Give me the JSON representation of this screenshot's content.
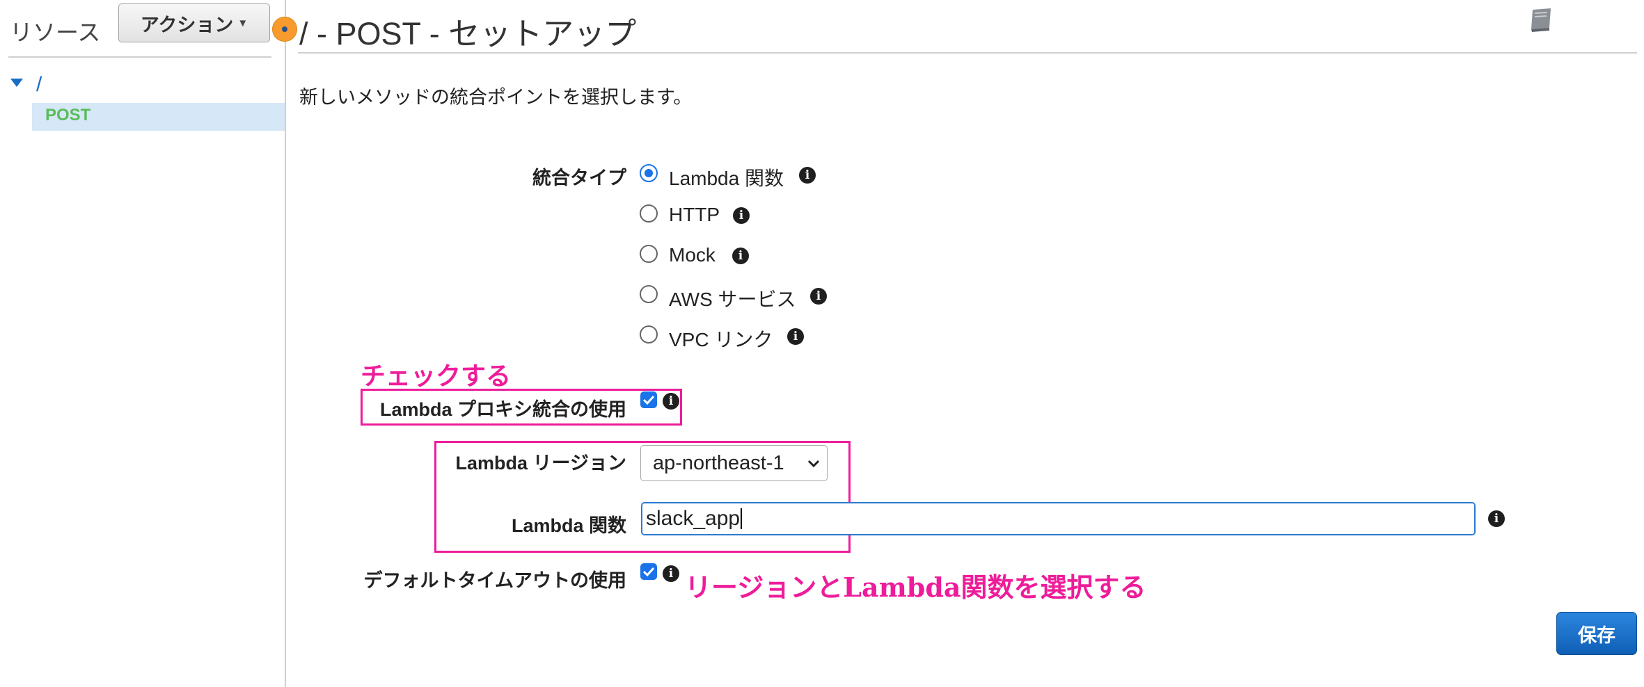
{
  "sidebar": {
    "resources_label": "リソース",
    "actions_button": "アクション",
    "tree": {
      "root": "/",
      "children": [
        {
          "label": "POST"
        }
      ]
    }
  },
  "header": {
    "title": "/ - POST - セットアップ"
  },
  "intro": "新しいメソッドの統合ポイントを選択します。",
  "form": {
    "integration_type": {
      "label": "統合タイプ",
      "options": [
        {
          "label": "Lambda 関数",
          "selected": true
        },
        {
          "label": "HTTP",
          "selected": false
        },
        {
          "label": "Mock",
          "selected": false
        },
        {
          "label": "AWS サービス",
          "selected": false
        },
        {
          "label": "VPC リンク",
          "selected": false
        }
      ]
    },
    "proxy": {
      "label": "Lambda プロキシ統合の使用",
      "checked": true
    },
    "region": {
      "label": "Lambda リージョン",
      "value": "ap-northeast-1"
    },
    "function": {
      "label": "Lambda 関数",
      "value": "slack_app"
    },
    "default_timeout": {
      "label": "デフォルトタイムアウトの使用",
      "checked": true
    },
    "save_label": "保存"
  },
  "annotations": {
    "check_note": "チェックする",
    "select_note": "リージョンとLambda関数を選択する"
  },
  "colors": {
    "accent": "#1a73e8",
    "annotation": "#ee1c9a",
    "save_button": "#1366c4",
    "tree_selected_bg": "#d6e7f8",
    "post_text": "#5abd5a"
  },
  "icons": {
    "info": "info-icon",
    "book": "book-icon",
    "caret": "caret-down-icon",
    "toggle": "panel-toggle-icon"
  }
}
